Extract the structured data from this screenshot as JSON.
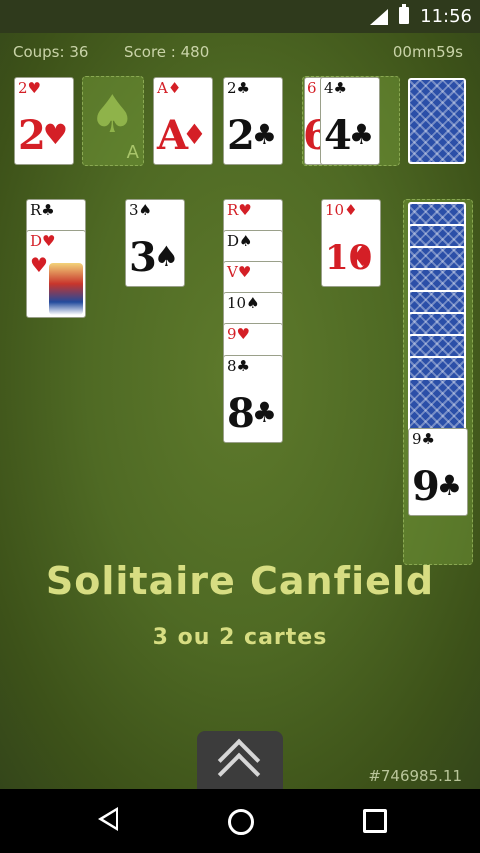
{
  "status_bar": {
    "time": "11:56"
  },
  "hud": {
    "moves": "Coups: 36",
    "score": "Score : 480",
    "timer": "00mn59s"
  },
  "foundations": {
    "f1": {
      "rank": "2",
      "suit": "♥",
      "color": "red"
    },
    "f2_placeholder": {
      "suit": "♠",
      "rank": "A"
    },
    "f3": {
      "rank": "A",
      "suit": "♦",
      "color": "red"
    },
    "f4": {
      "rank": "2",
      "suit": "♣",
      "color": "black"
    }
  },
  "waste": {
    "under": {
      "rank": "6",
      "suit": "♥"
    },
    "top": {
      "rank": "4",
      "suit": "♣",
      "color": "black"
    }
  },
  "tableau": {
    "col1": {
      "c1": {
        "rank": "R",
        "suit": "♣"
      },
      "c2": {
        "rank": "D",
        "suit": "♥"
      }
    },
    "col2": {
      "c1": {
        "rank": "3",
        "suit": "♠"
      }
    },
    "col3": {
      "c1": {
        "rank": "R",
        "suit": "♥"
      },
      "c2": {
        "rank": "D",
        "suit": "♠"
      },
      "c3": {
        "rank": "V",
        "suit": "♥"
      },
      "c4": {
        "rank": "10",
        "suit": "♠"
      },
      "c5": {
        "rank": "9",
        "suit": "♥"
      },
      "c6": {
        "rank": "8",
        "suit": "♣"
      }
    },
    "col4": {
      "c1": {
        "rank": "10",
        "suit": "♦"
      }
    }
  },
  "reserve": {
    "top": {
      "rank": "9",
      "suit": "♣"
    }
  },
  "title": "Solitaire Canfield",
  "subtitle": "3 ou 2 cartes",
  "build": "#746985.11",
  "colors": {
    "felt": "#4f6a24",
    "red_suit": "#d41f26",
    "title": "#d7dd82",
    "card_back": "#2b4fa8"
  }
}
